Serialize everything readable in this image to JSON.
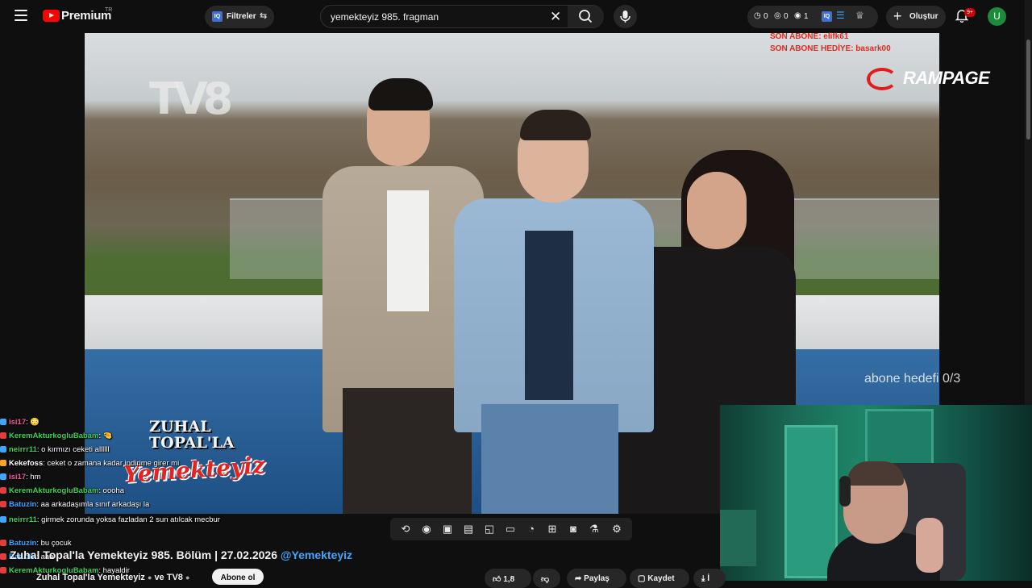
{
  "header": {
    "logo_text": "Premium",
    "region": "TR",
    "filters_label": "Filtreler",
    "search_value": "yemekteyiz 985. fragman",
    "stats": [
      "0",
      "0",
      "1"
    ],
    "create_label": "Oluştur",
    "notif_badge": "9+",
    "avatar_letter": "U"
  },
  "video": {
    "sub_overlay_last": "SON ABONE: elifk61",
    "sub_overlay_gift": "SON ABONE HEDİYE: basark00",
    "rampage_text": "RAMPAGE",
    "tv_logo": "TV8",
    "show_title_line1": "ZUHAL",
    "show_title_line2": "TOPAL'LA",
    "show_title_line3": "Yemekteyiz",
    "goal_text": "abone hedefi 0/3"
  },
  "chat": [
    {
      "user": "isi17",
      "msg": ": 😳",
      "color": "#e85d9a",
      "icon_color": "#3ea6ff"
    },
    {
      "user": "KeremAkturkogluBabam",
      "msg": ": 🤏",
      "color": "#39d353",
      "icon_color": "#e83b3b"
    },
    {
      "user": "neirrr11",
      "msg": ": o kırmızı ceketi allllll",
      "color": "#39d353",
      "icon_color": "#3ea6ff"
    },
    {
      "user": "Kekefoss",
      "msg": ": ceket o zamana kadar indirime girer mi",
      "color": "#ffffff",
      "icon_color": "#f5a623"
    },
    {
      "user": "isi17",
      "msg": ": hm",
      "color": "#e85d9a",
      "icon_color": "#3ea6ff"
    },
    {
      "user": "KeremAkturkogluBabam",
      "msg": ": oooha",
      "color": "#39d353",
      "icon_color": "#e83b3b"
    },
    {
      "user": "Batuzin",
      "msg": ": aa arkadaşımla sınıf arkadaşı la",
      "color": "#3ea6ff",
      "icon_color": "#e83b3b"
    },
    {
      "user": "neirrr11",
      "msg": ": girmek zorunda yoksa fazladan 2 sun atılcak mecbur",
      "color": "#39d353",
      "icon_color": "#3ea6ff"
    },
    {
      "user": "Batuzin",
      "msg": ": bu çocuk",
      "color": "#3ea6ff",
      "icon_color": "#e83b3b"
    },
    {
      "user": "Batuzin",
      "msg": ": aaa",
      "color": "#3ea6ff",
      "icon_color": "#e83b3b"
    },
    {
      "user": "KeremAkturkogluBabam",
      "msg": ": hayaldir",
      "color": "#39d353",
      "icon_color": "#e83b3b"
    }
  ],
  "controls": [
    "repeat-icon",
    "broadcast-icon",
    "video-settings-icon",
    "clapper-icon",
    "pip-icon",
    "theater-icon",
    "speed-icon",
    "add-icon",
    "screenshot-icon",
    "lab-icon",
    "settings-icon"
  ],
  "title": {
    "text": "Zuhal Topal'la Yemekteyiz 985. Bölüm | 27.02.2026",
    "tag": "@Yemekteyiz"
  },
  "channel": {
    "name": "Zuhal Topal'la Yemekteyiz",
    "and_text": "ve TV8",
    "subscribe_label": "Abone ol"
  },
  "actions": {
    "like_count": "1,8",
    "share_label": "Paylaş",
    "save_label": "Kaydet",
    "download_label": "İ"
  }
}
